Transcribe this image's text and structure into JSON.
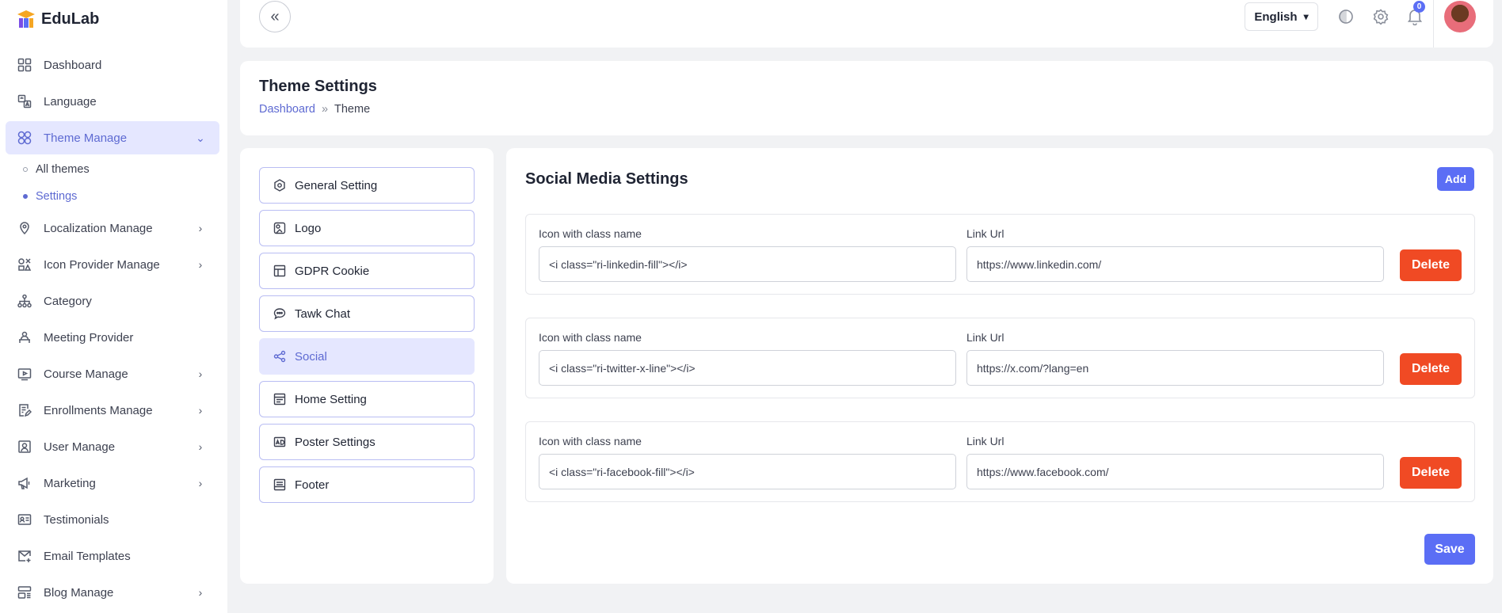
{
  "brand": {
    "name": "EduLab"
  },
  "sidebar": {
    "items": [
      {
        "label": "Dashboard",
        "icon": "grid-icon"
      },
      {
        "label": "Language",
        "icon": "translate-icon"
      },
      {
        "label": "Theme Manage",
        "icon": "palette-icon",
        "active": true,
        "expanded": true,
        "children": [
          {
            "label": "All themes"
          },
          {
            "label": "Settings",
            "active": true
          }
        ]
      },
      {
        "label": "Localization Manage",
        "icon": "map-pin-icon",
        "has_children": true
      },
      {
        "label": "Icon Provider Manage",
        "icon": "shapes-icon",
        "has_children": true
      },
      {
        "label": "Category",
        "icon": "sitemap-icon"
      },
      {
        "label": "Meeting Provider",
        "icon": "meeting-icon"
      },
      {
        "label": "Course Manage",
        "icon": "video-icon",
        "has_children": true
      },
      {
        "label": "Enrollments Manage",
        "icon": "edit-file-icon",
        "has_children": true
      },
      {
        "label": "User Manage",
        "icon": "user-box-icon",
        "has_children": true
      },
      {
        "label": "Marketing",
        "icon": "megaphone-icon",
        "has_children": true
      },
      {
        "label": "Testimonials",
        "icon": "id-card-icon"
      },
      {
        "label": "Email Templates",
        "icon": "mail-add-icon"
      },
      {
        "label": "Blog Manage",
        "icon": "layout-icon",
        "has_children": true
      }
    ]
  },
  "topbar": {
    "language": "English",
    "notification_count": "0",
    "icons": [
      "collapse-icon",
      "theme-toggle-icon",
      "settings-gear-icon",
      "bell-icon"
    ]
  },
  "header": {
    "title": "Theme Settings",
    "breadcrumb": {
      "link": "Dashboard",
      "separator": "»",
      "current": "Theme"
    }
  },
  "settings_tabs": [
    {
      "label": "General Setting",
      "icon": "hexagon-gear-icon"
    },
    {
      "label": "Logo",
      "icon": "logo-icon"
    },
    {
      "label": "GDPR Cookie",
      "icon": "cookie-panel-icon"
    },
    {
      "label": "Tawk Chat",
      "icon": "chat-bubble-icon"
    },
    {
      "label": "Social",
      "icon": "share-icon",
      "active": true
    },
    {
      "label": "Home Setting",
      "icon": "home-layout-icon"
    },
    {
      "label": "Poster Settings",
      "icon": "image-ad-icon"
    },
    {
      "label": "Footer",
      "icon": "footer-layout-icon"
    }
  ],
  "social": {
    "title": "Social Media Settings",
    "add_label": "Add",
    "icon_label": "Icon with class name",
    "url_label": "Link Url",
    "delete_label": "Delete",
    "save_label": "Save",
    "rows": [
      {
        "icon_class": "<i class=\"ri-linkedin-fill\"></i>",
        "url": "https://www.linkedin.com/"
      },
      {
        "icon_class": "<i class=\"ri-twitter-x-line\"></i>",
        "url": "https://x.com/?lang=en"
      },
      {
        "icon_class": "<i class=\"ri-facebook-fill\"></i>",
        "url": "https://www.facebook.com/"
      }
    ]
  },
  "colors": {
    "accent": "#5b6ef5",
    "danger": "#f04a24",
    "active_bg": "#e5e7ff"
  }
}
